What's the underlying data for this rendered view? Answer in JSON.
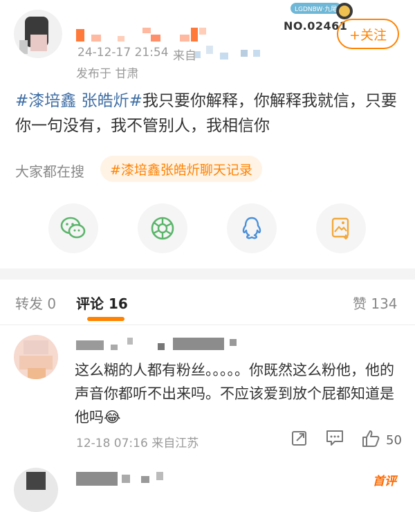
{
  "post": {
    "badge_number": "NO.02461",
    "badge_text": "LGDNBW·九尾",
    "follow_label": "+关注",
    "time": "24-12-17 21:54",
    "source": "来自",
    "location": "发布于 甘肃",
    "hashtag": "#漆培鑫 张皓炘#",
    "text_rest": "我只要你解释，你解释我就信，只要你一句没有，我不管别人，我相信你",
    "search_label": "大家都在搜",
    "search_chip": "#漆培鑫张皓炘聊天记录"
  },
  "share": {
    "items": [
      {
        "icon": "wechat-icon",
        "color": "#5bb56b"
      },
      {
        "icon": "moments-icon",
        "color": "#5bb56b"
      },
      {
        "icon": "qq-icon",
        "color": "#4a90d9"
      },
      {
        "icon": "save-image-icon",
        "color": "#f2a83a"
      }
    ]
  },
  "tabs": {
    "repost": "转发 0",
    "comments": "评论 16",
    "likes": "赞 134"
  },
  "comment": {
    "text": "这么糊的人都有粉丝。。。。。你既然这么粉他，他的声音你都听不出来吗。不应该爱到放个屁都知道是他吗😂",
    "meta": "12-18 07:16 来自江苏",
    "like_count": "50"
  },
  "next_comment": {
    "badge": "首评"
  },
  "colors": {
    "accent": "#ff8200",
    "link": "#3f6ea5"
  }
}
